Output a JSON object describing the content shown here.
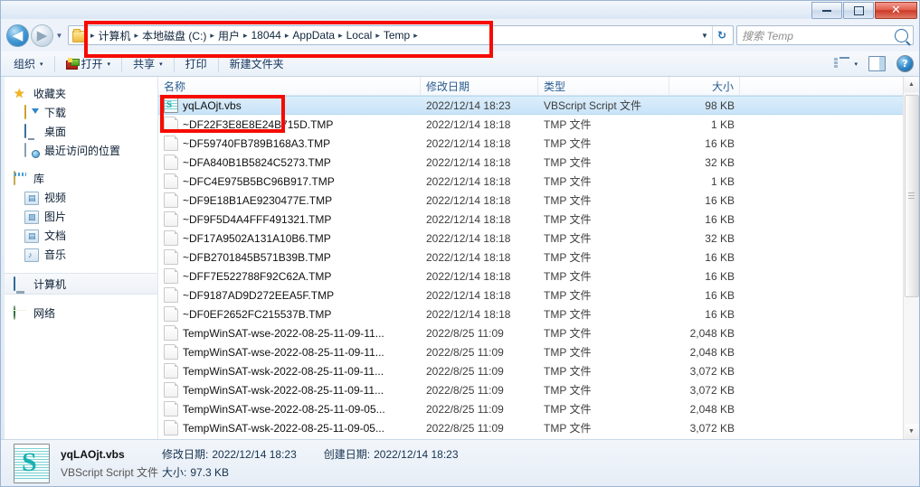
{
  "window": {
    "minimize_label": "Minimize",
    "maximize_label": "Maximize",
    "close_label": "✕"
  },
  "address_bar": {
    "back_glyph": "◀",
    "forward_glyph": "▶",
    "history_caret": "▼",
    "breadcrumbs": [
      "计算机",
      "本地磁盘 (C:)",
      "用户",
      "18044",
      "AppData",
      "Local",
      "Temp"
    ],
    "separator": "▸",
    "dropdown_caret": "▼",
    "refresh_glyph": "↻"
  },
  "search": {
    "placeholder": "搜索 Temp",
    "value": ""
  },
  "toolbar": {
    "organize_label": "组织",
    "open_label": "打开",
    "share_label": "共享",
    "print_label": "打印",
    "new_folder_label": "新建文件夹",
    "caret": "▾",
    "view_caret": "▾",
    "help_glyph": "?"
  },
  "sidebar": {
    "groups": [
      {
        "header": {
          "label": "收藏夹",
          "icon": "star-icon"
        },
        "items": [
          {
            "label": "下载",
            "icon": "download-folder-icon"
          },
          {
            "label": "桌面",
            "icon": "desktop-icon"
          },
          {
            "label": "最近访问的位置",
            "icon": "recent-places-icon"
          }
        ]
      },
      {
        "header": {
          "label": "库",
          "icon": "library-icon"
        },
        "items": [
          {
            "label": "视频",
            "icon": "videos-icon"
          },
          {
            "label": "图片",
            "icon": "pictures-icon"
          },
          {
            "label": "文档",
            "icon": "documents-icon"
          },
          {
            "label": "音乐",
            "icon": "music-icon"
          }
        ]
      },
      {
        "header": {
          "label": "计算机",
          "icon": "computer-icon",
          "selected": true
        },
        "items": []
      },
      {
        "header": {
          "label": "网络",
          "icon": "network-icon"
        },
        "items": []
      }
    ]
  },
  "file_list": {
    "columns": [
      "名称",
      "修改日期",
      "类型",
      "大小"
    ],
    "rows": [
      {
        "name": "yqLAOjt.vbs",
        "date": "2022/12/14 18:23",
        "type": "VBScript Script 文件",
        "size": "98 KB",
        "icon": "vbs-file-icon",
        "selected": true
      },
      {
        "name": "~DF22F3E8E8E24B715D.TMP",
        "date": "2022/12/14 18:18",
        "type": "TMP 文件",
        "size": "1 KB",
        "icon": "tmp-file-icon",
        "selected": false
      },
      {
        "name": "~DF59740FB789B168A3.TMP",
        "date": "2022/12/14 18:18",
        "type": "TMP 文件",
        "size": "16 KB",
        "icon": "tmp-file-icon",
        "selected": false
      },
      {
        "name": "~DFA840B1B5824C5273.TMP",
        "date": "2022/12/14 18:18",
        "type": "TMP 文件",
        "size": "32 KB",
        "icon": "tmp-file-icon",
        "selected": false
      },
      {
        "name": "~DFC4E975B5BC96B917.TMP",
        "date": "2022/12/14 18:18",
        "type": "TMP 文件",
        "size": "1 KB",
        "icon": "tmp-file-icon",
        "selected": false
      },
      {
        "name": "~DF9E18B1AE9230477E.TMP",
        "date": "2022/12/14 18:18",
        "type": "TMP 文件",
        "size": "16 KB",
        "icon": "tmp-file-icon",
        "selected": false
      },
      {
        "name": "~DF9F5D4A4FFF491321.TMP",
        "date": "2022/12/14 18:18",
        "type": "TMP 文件",
        "size": "16 KB",
        "icon": "tmp-file-icon",
        "selected": false
      },
      {
        "name": "~DF17A9502A131A10B6.TMP",
        "date": "2022/12/14 18:18",
        "type": "TMP 文件",
        "size": "32 KB",
        "icon": "tmp-file-icon",
        "selected": false
      },
      {
        "name": "~DFB2701845B571B39B.TMP",
        "date": "2022/12/14 18:18",
        "type": "TMP 文件",
        "size": "16 KB",
        "icon": "tmp-file-icon",
        "selected": false
      },
      {
        "name": "~DFF7E522788F92C62A.TMP",
        "date": "2022/12/14 18:18",
        "type": "TMP 文件",
        "size": "16 KB",
        "icon": "tmp-file-icon",
        "selected": false
      },
      {
        "name": "~DF9187AD9D272EEA5F.TMP",
        "date": "2022/12/14 18:18",
        "type": "TMP 文件",
        "size": "16 KB",
        "icon": "tmp-file-icon",
        "selected": false
      },
      {
        "name": "~DF0EF2652FC215537B.TMP",
        "date": "2022/12/14 18:18",
        "type": "TMP 文件",
        "size": "16 KB",
        "icon": "tmp-file-icon",
        "selected": false
      },
      {
        "name": "TempWinSAT-wse-2022-08-25-11-09-11...",
        "date": "2022/8/25 11:09",
        "type": "TMP 文件",
        "size": "2,048 KB",
        "icon": "tmp-file-icon",
        "selected": false
      },
      {
        "name": "TempWinSAT-wse-2022-08-25-11-09-11...",
        "date": "2022/8/25 11:09",
        "type": "TMP 文件",
        "size": "2,048 KB",
        "icon": "tmp-file-icon",
        "selected": false
      },
      {
        "name": "TempWinSAT-wsk-2022-08-25-11-09-11...",
        "date": "2022/8/25 11:09",
        "type": "TMP 文件",
        "size": "3,072 KB",
        "icon": "tmp-file-icon",
        "selected": false
      },
      {
        "name": "TempWinSAT-wsk-2022-08-25-11-09-11...",
        "date": "2022/8/25 11:09",
        "type": "TMP 文件",
        "size": "3,072 KB",
        "icon": "tmp-file-icon",
        "selected": false
      },
      {
        "name": "TempWinSAT-wse-2022-08-25-11-09-05...",
        "date": "2022/8/25 11:09",
        "type": "TMP 文件",
        "size": "2,048 KB",
        "icon": "tmp-file-icon",
        "selected": false
      },
      {
        "name": "TempWinSAT-wsk-2022-08-25-11-09-05...",
        "date": "2022/8/25 11:09",
        "type": "TMP 文件",
        "size": "3,072 KB",
        "icon": "tmp-file-icon",
        "selected": false
      }
    ]
  },
  "scrollbar": {
    "up_glyph": "▲",
    "down_glyph": "▼"
  },
  "details_pane": {
    "file_name": "yqLAOjt.vbs",
    "file_type": "VBScript Script 文件",
    "modified_label": "修改日期:",
    "modified_value": "2022/12/14 18:23",
    "created_label": "创建日期:",
    "created_value": "2022/12/14 18:23",
    "size_label": "大小:",
    "size_value": "97.3 KB"
  },
  "annotations": {
    "accent_color": "#f60b00",
    "boxes": [
      "address-bar-highlight",
      "selected-file-highlight"
    ]
  }
}
